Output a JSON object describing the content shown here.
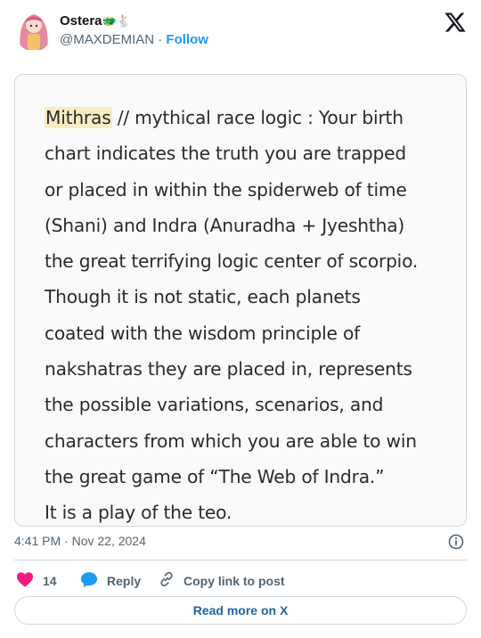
{
  "author": {
    "name": "Ostera",
    "name_emojis": "🐲🐇",
    "handle": "@MAXDEMIAN",
    "separator": " · ",
    "follow_label": "Follow"
  },
  "post": {
    "highlight_word": "Mithras",
    "lines": [
      " // mythical race logic : Your birth",
      "chart indicates the truth you are trapped",
      "or placed in within the spiderweb of time",
      "(Shani) and Indra (Anuradha + Jyeshtha)",
      "the great terrifying logic center of scorpio.",
      "Though it is not static, each planets",
      "coated with the wisdom principle of",
      "nakshatras they are placed in, represents",
      "the possible variations, scenarios, and",
      "characters from which you are able to win",
      "the great game of “The Web of Indra.”",
      "It is a play of the teo."
    ]
  },
  "meta": {
    "timestamp": "4:41 PM · Nov 22, 2024"
  },
  "actions": {
    "like_count": "14",
    "reply_label": "Reply",
    "copy_label": "Copy link to post"
  },
  "footer": {
    "read_more_label": "Read more on X"
  },
  "icons": {
    "heart": "heart-icon",
    "reply": "reply-bubble-icon",
    "copy": "link-icon",
    "info": "info-icon",
    "logo": "x-logo-icon"
  },
  "colors": {
    "accent": "#1d9bf0",
    "like": "#f91880",
    "highlight": "#f8ecc0"
  }
}
